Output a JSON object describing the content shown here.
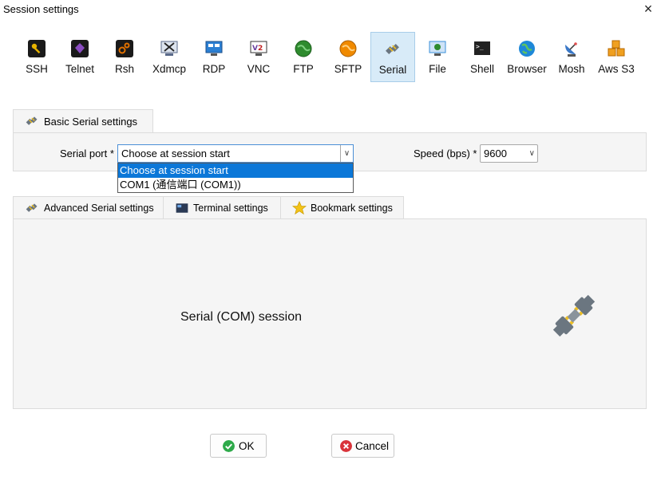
{
  "window": {
    "title": "Session settings",
    "close_symbol": "×"
  },
  "protocols": [
    {
      "label": "SSH",
      "icon": "key-icon",
      "color": "#e8b400"
    },
    {
      "label": "Telnet",
      "icon": "telnet-icon",
      "color": "#7b3fa0"
    },
    {
      "label": "Rsh",
      "icon": "gears-icon",
      "color": "#e07000"
    },
    {
      "label": "Xdmcp",
      "icon": "xdmcp-icon",
      "color": "#5a6a8a"
    },
    {
      "label": "RDP",
      "icon": "rdp-monitor-icon",
      "color": "#2b7fd3"
    },
    {
      "label": "VNC",
      "icon": "vnc-icon",
      "color": "#6a3fa0"
    },
    {
      "label": "FTP",
      "icon": "ftp-globe-icon",
      "color": "#2e8b2e"
    },
    {
      "label": "SFTP",
      "icon": "sftp-globe-icon",
      "color": "#f08a00"
    },
    {
      "label": "Serial",
      "icon": "serial-plug-icon",
      "color": "#6b7680",
      "selected": true
    },
    {
      "label": "File",
      "icon": "file-monitor-icon",
      "color": "#3a8fd8"
    },
    {
      "label": "Shell",
      "icon": "shell-terminal-icon",
      "color": "#222222"
    },
    {
      "label": "Browser",
      "icon": "browser-globe-icon",
      "color": "#1e88d8"
    },
    {
      "label": "Mosh",
      "icon": "satellite-dish-icon",
      "color": "#3a78c8"
    },
    {
      "label": "Aws S3",
      "icon": "aws-s3-cubes-icon",
      "color": "#f0a020"
    }
  ],
  "basic_tab": {
    "label": "Basic Serial settings"
  },
  "serial_port": {
    "label": "Serial port *",
    "value": "Choose at session start",
    "options": [
      "Choose at session start",
      "COM1  (通信端口 (COM1))"
    ]
  },
  "speed": {
    "label": "Speed (bps) *",
    "value": "9600"
  },
  "sub_tabs": [
    {
      "label": "Advanced Serial settings",
      "icon": "serial-plug-icon"
    },
    {
      "label": "Terminal settings",
      "icon": "terminal-icon"
    },
    {
      "label": "Bookmark settings",
      "icon": "star-icon"
    }
  ],
  "session_label": "Serial (COM) session",
  "buttons": {
    "ok": "OK",
    "cancel": "Cancel"
  },
  "colors": {
    "accent": "#0b77d8",
    "selected_tab_bg": "#d8ebf8",
    "ok_green": "#2eaa4a",
    "cancel_red": "#d9343a"
  }
}
